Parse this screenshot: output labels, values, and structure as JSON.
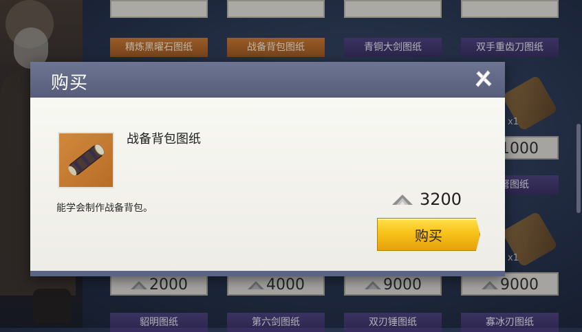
{
  "background_shop": {
    "top_row_titles": [
      "精炼黑曜石图纸",
      "战备背包图纸",
      "青铜大剑图纸",
      "双手重齿刀图纸"
    ],
    "right_column": {
      "price_1": "1000",
      "title_2": "硬弩图纸",
      "qty_1": "x1",
      "qty_2": "x1"
    },
    "bottom_prices": [
      "2000",
      "4000",
      "9000",
      "9000"
    ],
    "bottom_row_titles": [
      "貂明图纸",
      "第六剑图纸",
      "双刃锤图纸",
      "寡冰刃图纸"
    ]
  },
  "modal": {
    "title": "购买",
    "item_name": "战备背包图纸",
    "item_description": "能学会制作战备背包。",
    "price": "3200",
    "buy_label": "购买"
  },
  "colors": {
    "header": "#5f6684",
    "button": "#f7c21a",
    "item_frame": "#c47a32"
  }
}
